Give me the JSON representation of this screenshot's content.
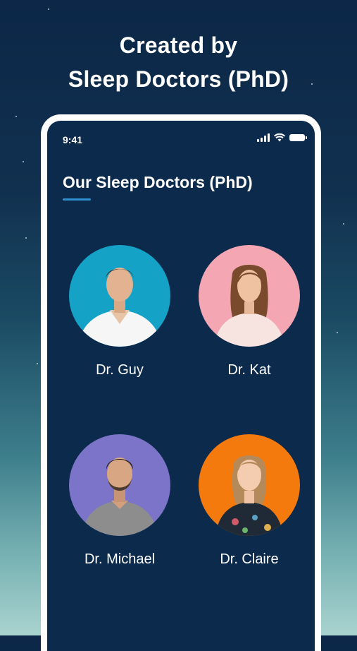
{
  "headline": {
    "line1": "Created by",
    "line2": "Sleep Doctors (PhD)"
  },
  "phone": {
    "status_time": "9:41",
    "section_title": "Our Sleep Doctors (PhD)",
    "accent_color": "#2f8fcf"
  },
  "doctors": [
    {
      "name": "Dr. Guy",
      "bg_color": "#14a2c6"
    },
    {
      "name": "Dr. Kat",
      "bg_color": "#f4a6b2"
    },
    {
      "name": "Dr. Michael",
      "bg_color": "#7c74c9"
    },
    {
      "name": "Dr. Claire",
      "bg_color": "#f57a0e"
    }
  ]
}
